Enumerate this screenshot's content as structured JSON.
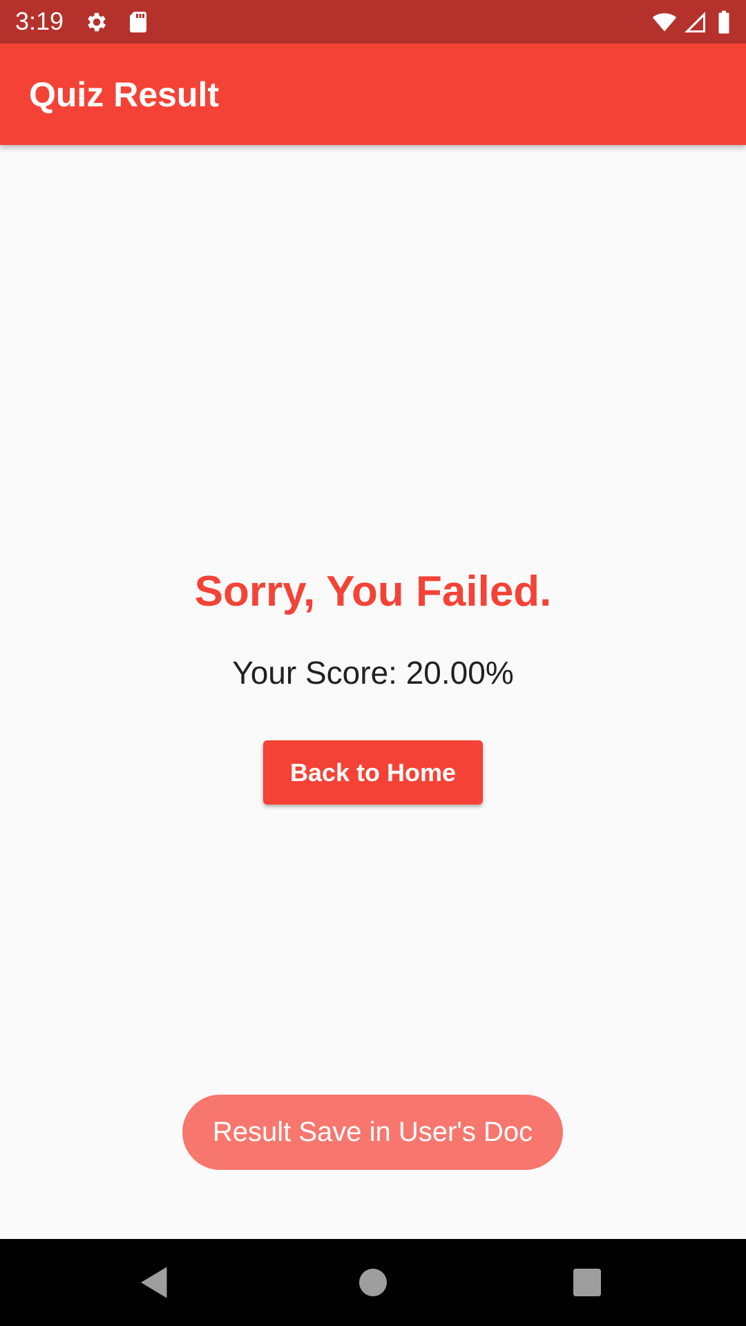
{
  "status_bar": {
    "time": "3:19",
    "icons": [
      "gear-icon",
      "sd-card-icon",
      "wifi-icon",
      "signal-icon",
      "battery-icon"
    ],
    "background": "#b5312b"
  },
  "app_bar": {
    "title": "Quiz Result",
    "background": "#f44336"
  },
  "result": {
    "title": "Sorry, You Failed.",
    "score_text": "Your Score: 20.00%",
    "title_color": "#f44336"
  },
  "actions": {
    "home_label": "Back to Home"
  },
  "toast": {
    "message": "Result Save in User's Doc",
    "background": "#f7776f"
  },
  "nav_bar": {
    "icons": [
      "back-icon",
      "home-icon",
      "recents-icon"
    ]
  }
}
